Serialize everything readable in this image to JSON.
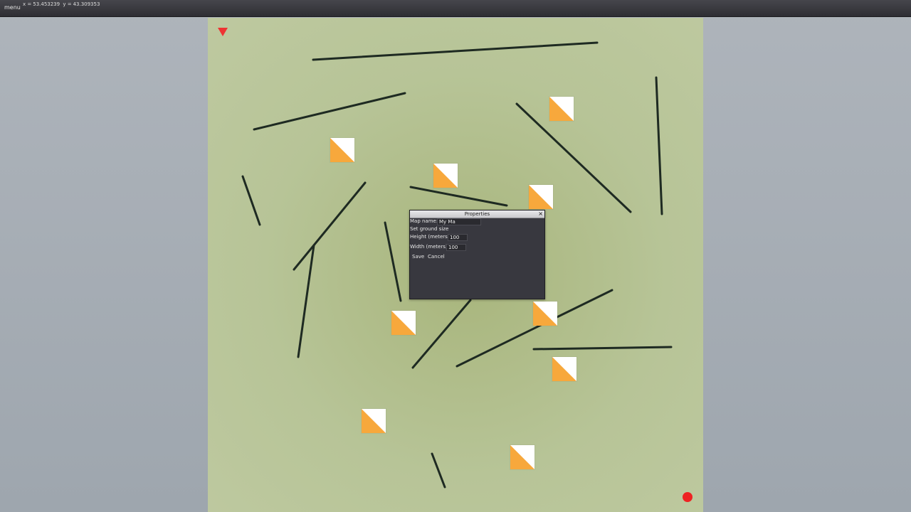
{
  "topbar": {
    "menu_label": "menu",
    "coord_x_label": "x =",
    "coord_x_value": "53.453239",
    "coord_y_label": "y =",
    "coord_y_value": "43.309353"
  },
  "map": {
    "background_color": "#b7c497",
    "line_color": "#1e2a22",
    "flag_colors": {
      "light": "#ffffff",
      "accent": "#f7a83c"
    },
    "start_marker": {
      "icon": "red-triangle-icon",
      "color": "#ee3333"
    },
    "end_marker": {
      "icon": "red-circle-icon",
      "color": "#ee2222"
    }
  },
  "dialog": {
    "title": "Properties",
    "close_icon": "×",
    "map_name_label": "Map name:",
    "map_name_value": "My Ma",
    "ground_size_heading": "Set ground size",
    "height_label": "Height (meters)",
    "height_value": "100",
    "width_label": "Width (meters)",
    "width_value": "100",
    "save_label": "Save",
    "cancel_label": "Cancel"
  }
}
